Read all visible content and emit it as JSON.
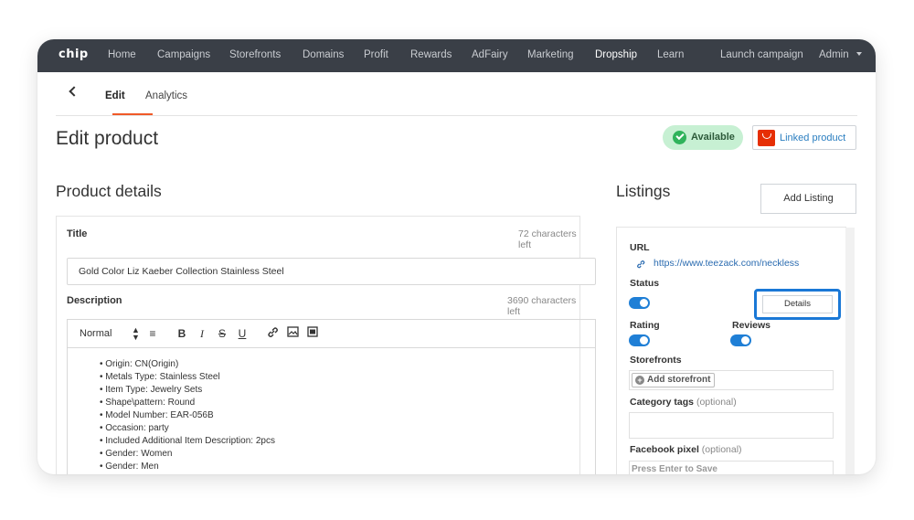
{
  "brand": "chip",
  "nav": {
    "items": [
      "Home",
      "Campaigns",
      "Storefronts",
      "Domains",
      "Profit",
      "Rewards",
      "AdFairy",
      "Marketing",
      "Dropship",
      "Learn"
    ],
    "active": "Dropship",
    "launch": "Launch campaign",
    "admin": "Admin"
  },
  "tabs": {
    "edit": "Edit",
    "analytics": "Analytics",
    "active": "Edit"
  },
  "page": {
    "title": "Edit product"
  },
  "status_badge": "Available",
  "linked_product": "Linked product",
  "product_details": {
    "heading": "Product details",
    "title_label": "Title",
    "title_count": "72 characters left",
    "title_value": "Gold Color Liz Kaeber Collection Stainless Steel",
    "description_label": "Description",
    "description_count": "3690 characters left",
    "format_select": "Normal",
    "description_lines": [
      "Origin: CN(Origin)",
      "Metals Type: Stainless Steel",
      "Item Type: Jewelry Sets",
      "Shape\\pattern: Round",
      "Model Number: EAR-056B",
      "Occasion: party",
      "Included Additional Item Description: 2pcs",
      "Gender: Women",
      "Gender: Men"
    ]
  },
  "listings": {
    "heading": "Listings",
    "add_button": "Add Listing",
    "url_label": "URL",
    "url": "https://www.teezack.com/neckless",
    "status_label": "Status",
    "status_on": true,
    "details_button": "Details",
    "rating_label": "Rating",
    "rating_on": true,
    "reviews_label": "Reviews",
    "reviews_on": true,
    "storefronts_label": "Storefronts",
    "add_storefront": "Add storefront",
    "category_label": "Category tags",
    "category_optional": "(optional)",
    "fb_label": "Facebook pixel",
    "fb_optional": "(optional)",
    "fb_placeholder": "Press Enter to Save"
  }
}
